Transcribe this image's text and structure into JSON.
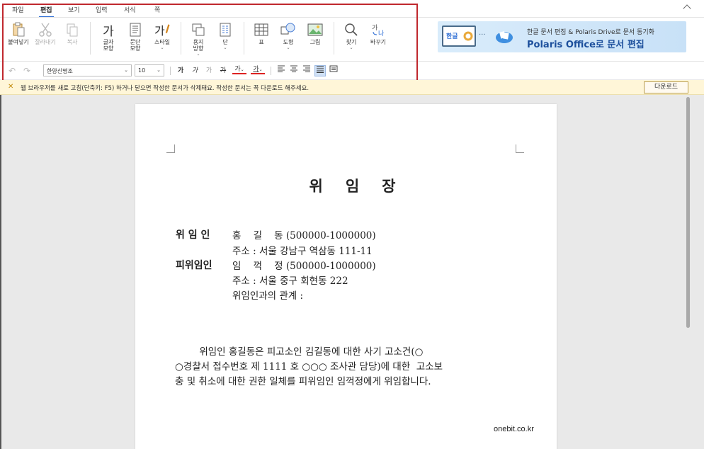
{
  "menu": {
    "tabs": [
      {
        "label": "파일"
      },
      {
        "label": "편집"
      },
      {
        "label": "보기"
      },
      {
        "label": "입력"
      },
      {
        "label": "서식"
      },
      {
        "label": "쪽"
      }
    ]
  },
  "ribbon": {
    "paste": "붙여넣기",
    "cut": "잘라내기",
    "copy": "복사",
    "char_shape": "글자\n모양",
    "para_shape": "문단\n모양",
    "style": "스타일",
    "paper_dir": "용지\n방향",
    "column": "단",
    "table": "표",
    "shape": "도형",
    "image": "그림",
    "find": "찾기",
    "replace": "바꾸기",
    "char_glyph": "가",
    "style_glyph": "가"
  },
  "promo": {
    "line1": "한글 문서 편집 & Polaris Drive로 문서 동기화",
    "line2": "Polaris Office로 문서 편집",
    "monitor_text": "한글"
  },
  "format": {
    "font": "한양신명조",
    "size": "10",
    "bold": "가",
    "italic": "가",
    "outline": "가",
    "strike": "가",
    "color": "가",
    "highlight": "가"
  },
  "notice": {
    "message": "웹 브라우저를 새로 고침(단축키: F5) 하거나 닫으면 작성한 문서가 삭제돼요. 작성한 문서는 꼭 다운로드 해주세요.",
    "download": "다운로드"
  },
  "document": {
    "title": "위임장",
    "delegator_label": "위 임 인",
    "delegator_name": "홍    길    동 (500000-1000000)",
    "delegator_addr": "주소 : 서울 강남구 역삼동 111-11",
    "delegate_label": "피위임인",
    "delegate_name": "임    꺽    정 (500000-1000000)",
    "delegate_addr": "주소 : 서울 중구 회현동 222",
    "relation": "위임인과의 관계 :",
    "body": "        위임인 홍길동은 피고소인 김길동에 대한 사기 고소건(○\n○경찰서 접수번호 제 1111 호 ○○○ 조사관 담당)에 대한  고소보\n충 및 취소에 대한 권한 일체를 피위임인 임꺽정에게 위임합니다."
  },
  "watermark": "onebit.co.kr",
  "colors": {
    "accent": "#2b6cd4",
    "highlight_border": "#c0282e",
    "notice_bg": "#fff6d8"
  }
}
